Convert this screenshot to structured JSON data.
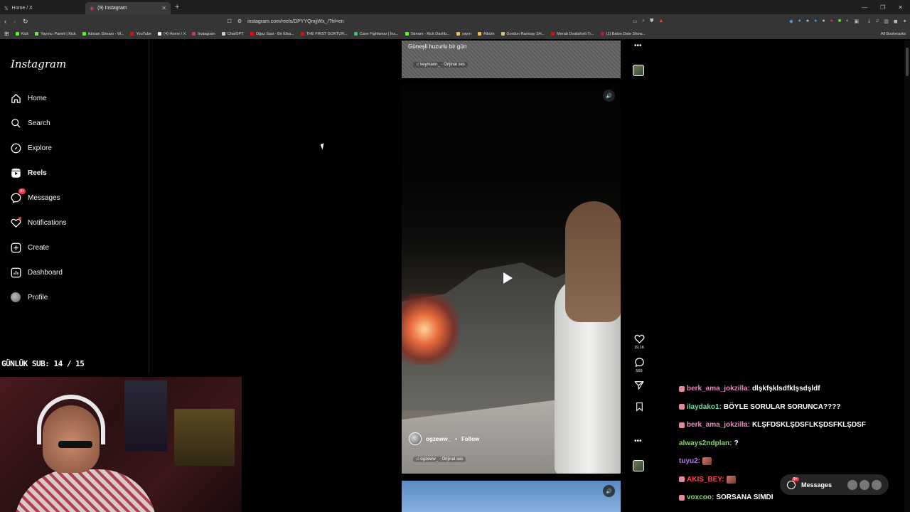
{
  "browser": {
    "tabs": [
      {
        "label": "Home / X",
        "active": false
      },
      {
        "label": "(9) Instagram",
        "active": true
      }
    ],
    "url": "instagram.com/reels/DPYYQmjjWx_/?hl=en",
    "bookmarks": [
      {
        "label": "Kick",
        "color": "#53fc18"
      },
      {
        "label": "Yayıncı Paneli | Kick",
        "color": "#53fc18"
      },
      {
        "label": "ikinsan Stream - W...",
        "color": "#53fc18"
      },
      {
        "label": "YouTube",
        "color": "#ff0000"
      },
      {
        "label": "(4) Home / X",
        "color": "#ffffff"
      },
      {
        "label": "Instagram",
        "color": "#c13584"
      },
      {
        "label": "ChatGPT",
        "color": "#cccccc"
      },
      {
        "label": "Oğuz Sasi - Bir Efsa...",
        "color": "#ff0000"
      },
      {
        "label": "THE FIRST GOKTUR...",
        "color": "#ff0000"
      },
      {
        "label": "Cave Fightwear | İns...",
        "color": "#3ac26a"
      },
      {
        "label": "Stream - Kick Dashb...",
        "color": "#53fc18"
      },
      {
        "label": "yayın",
        "color": "#e8c44a"
      },
      {
        "label": "Albüm",
        "color": "#e8c44a"
      },
      {
        "label": "Gordon Ramsay SH...",
        "color": "#e8c44a"
      },
      {
        "label": "Merab Dvalishvili Tr...",
        "color": "#ff0000"
      },
      {
        "label": "(1) Balon Date Show...",
        "color": "#ff0000"
      }
    ],
    "all_bookmarks": "All Bookmarks"
  },
  "sidebar": {
    "logo": "Instagram",
    "items": [
      {
        "label": "Home",
        "icon": "home-icon"
      },
      {
        "label": "Search",
        "icon": "search-icon"
      },
      {
        "label": "Explore",
        "icon": "compass-icon"
      },
      {
        "label": "Reels",
        "icon": "reels-icon",
        "active": true
      },
      {
        "label": "Messages",
        "icon": "messenger-icon",
        "badge": "9+"
      },
      {
        "label": "Notifications",
        "icon": "heart-icon",
        "dot": true
      },
      {
        "label": "Create",
        "icon": "plus-square-icon"
      },
      {
        "label": "Dashboard",
        "icon": "chart-icon"
      },
      {
        "label": "Profile",
        "icon": "avatar-icon"
      }
    ]
  },
  "overlay": {
    "sub_counter": "GÜNLÜK SUB: 14 / 15"
  },
  "reels": {
    "top": {
      "caption": "Güneşli huzurlu bir gün",
      "audio": "keymann_ · Orijinal ses"
    },
    "main": {
      "author": "ogzeww_",
      "separator": "•",
      "follow": "Follow",
      "audio": "ogzeww_ · Orijinal ses",
      "likes": "19,1K",
      "comments": "569"
    }
  },
  "chat": [
    {
      "user": "berk_ama_jokzilla:",
      "text": "dlşkfşklsdfklşsdşldf",
      "color": "#e78abc",
      "badge": true
    },
    {
      "user": "ilaydako1:",
      "text": "BÖYLE SORULAR SORUNCA????",
      "color": "#6cd8a8",
      "badge": true
    },
    {
      "user": "berk_ama_jokzilla:",
      "text": "KLŞFDSKLŞDSFLKŞDSFKLŞDSF",
      "color": "#e78abc",
      "badge": true
    },
    {
      "user": "always2ndplan:",
      "text": "?",
      "color": "#7ed86c",
      "badge": false
    },
    {
      "user": "tuyu2:",
      "text": "",
      "color": "#b07ae0",
      "badge": false,
      "emote": true
    },
    {
      "user": "AKIS_BEY:",
      "text": "",
      "color": "#ff4a4a",
      "badge": true,
      "emote": true
    },
    {
      "user": "voxcoo:",
      "text": "SORSANA SIMDI",
      "color": "#7ed86c",
      "badge": true
    }
  ],
  "messages_pill": {
    "label": "Messages",
    "badge": "9+"
  }
}
